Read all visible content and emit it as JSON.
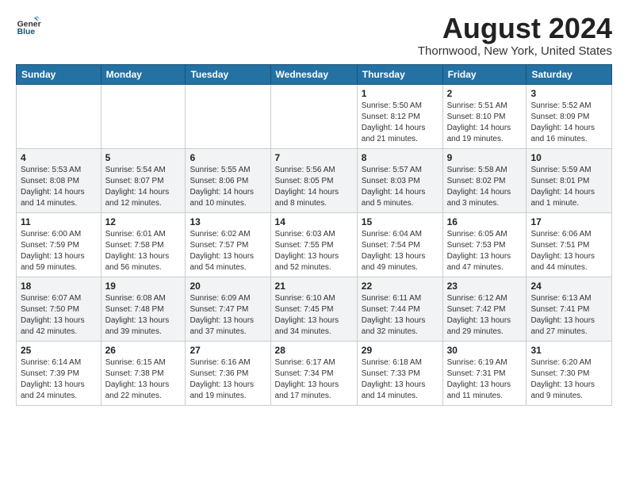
{
  "header": {
    "logo_line1": "General",
    "logo_line2": "Blue",
    "month_year": "August 2024",
    "location": "Thornwood, New York, United States"
  },
  "days_of_week": [
    "Sunday",
    "Monday",
    "Tuesday",
    "Wednesday",
    "Thursday",
    "Friday",
    "Saturday"
  ],
  "weeks": [
    [
      {
        "day": "",
        "info": ""
      },
      {
        "day": "",
        "info": ""
      },
      {
        "day": "",
        "info": ""
      },
      {
        "day": "",
        "info": ""
      },
      {
        "day": "1",
        "info": "Sunrise: 5:50 AM\nSunset: 8:12 PM\nDaylight: 14 hours\nand 21 minutes."
      },
      {
        "day": "2",
        "info": "Sunrise: 5:51 AM\nSunset: 8:10 PM\nDaylight: 14 hours\nand 19 minutes."
      },
      {
        "day": "3",
        "info": "Sunrise: 5:52 AM\nSunset: 8:09 PM\nDaylight: 14 hours\nand 16 minutes."
      }
    ],
    [
      {
        "day": "4",
        "info": "Sunrise: 5:53 AM\nSunset: 8:08 PM\nDaylight: 14 hours\nand 14 minutes."
      },
      {
        "day": "5",
        "info": "Sunrise: 5:54 AM\nSunset: 8:07 PM\nDaylight: 14 hours\nand 12 minutes."
      },
      {
        "day": "6",
        "info": "Sunrise: 5:55 AM\nSunset: 8:06 PM\nDaylight: 14 hours\nand 10 minutes."
      },
      {
        "day": "7",
        "info": "Sunrise: 5:56 AM\nSunset: 8:05 PM\nDaylight: 14 hours\nand 8 minutes."
      },
      {
        "day": "8",
        "info": "Sunrise: 5:57 AM\nSunset: 8:03 PM\nDaylight: 14 hours\nand 5 minutes."
      },
      {
        "day": "9",
        "info": "Sunrise: 5:58 AM\nSunset: 8:02 PM\nDaylight: 14 hours\nand 3 minutes."
      },
      {
        "day": "10",
        "info": "Sunrise: 5:59 AM\nSunset: 8:01 PM\nDaylight: 14 hours\nand 1 minute."
      }
    ],
    [
      {
        "day": "11",
        "info": "Sunrise: 6:00 AM\nSunset: 7:59 PM\nDaylight: 13 hours\nand 59 minutes."
      },
      {
        "day": "12",
        "info": "Sunrise: 6:01 AM\nSunset: 7:58 PM\nDaylight: 13 hours\nand 56 minutes."
      },
      {
        "day": "13",
        "info": "Sunrise: 6:02 AM\nSunset: 7:57 PM\nDaylight: 13 hours\nand 54 minutes."
      },
      {
        "day": "14",
        "info": "Sunrise: 6:03 AM\nSunset: 7:55 PM\nDaylight: 13 hours\nand 52 minutes."
      },
      {
        "day": "15",
        "info": "Sunrise: 6:04 AM\nSunset: 7:54 PM\nDaylight: 13 hours\nand 49 minutes."
      },
      {
        "day": "16",
        "info": "Sunrise: 6:05 AM\nSunset: 7:53 PM\nDaylight: 13 hours\nand 47 minutes."
      },
      {
        "day": "17",
        "info": "Sunrise: 6:06 AM\nSunset: 7:51 PM\nDaylight: 13 hours\nand 44 minutes."
      }
    ],
    [
      {
        "day": "18",
        "info": "Sunrise: 6:07 AM\nSunset: 7:50 PM\nDaylight: 13 hours\nand 42 minutes."
      },
      {
        "day": "19",
        "info": "Sunrise: 6:08 AM\nSunset: 7:48 PM\nDaylight: 13 hours\nand 39 minutes."
      },
      {
        "day": "20",
        "info": "Sunrise: 6:09 AM\nSunset: 7:47 PM\nDaylight: 13 hours\nand 37 minutes."
      },
      {
        "day": "21",
        "info": "Sunrise: 6:10 AM\nSunset: 7:45 PM\nDaylight: 13 hours\nand 34 minutes."
      },
      {
        "day": "22",
        "info": "Sunrise: 6:11 AM\nSunset: 7:44 PM\nDaylight: 13 hours\nand 32 minutes."
      },
      {
        "day": "23",
        "info": "Sunrise: 6:12 AM\nSunset: 7:42 PM\nDaylight: 13 hours\nand 29 minutes."
      },
      {
        "day": "24",
        "info": "Sunrise: 6:13 AM\nSunset: 7:41 PM\nDaylight: 13 hours\nand 27 minutes."
      }
    ],
    [
      {
        "day": "25",
        "info": "Sunrise: 6:14 AM\nSunset: 7:39 PM\nDaylight: 13 hours\nand 24 minutes."
      },
      {
        "day": "26",
        "info": "Sunrise: 6:15 AM\nSunset: 7:38 PM\nDaylight: 13 hours\nand 22 minutes."
      },
      {
        "day": "27",
        "info": "Sunrise: 6:16 AM\nSunset: 7:36 PM\nDaylight: 13 hours\nand 19 minutes."
      },
      {
        "day": "28",
        "info": "Sunrise: 6:17 AM\nSunset: 7:34 PM\nDaylight: 13 hours\nand 17 minutes."
      },
      {
        "day": "29",
        "info": "Sunrise: 6:18 AM\nSunset: 7:33 PM\nDaylight: 13 hours\nand 14 minutes."
      },
      {
        "day": "30",
        "info": "Sunrise: 6:19 AM\nSunset: 7:31 PM\nDaylight: 13 hours\nand 11 minutes."
      },
      {
        "day": "31",
        "info": "Sunrise: 6:20 AM\nSunset: 7:30 PM\nDaylight: 13 hours\nand 9 minutes."
      }
    ]
  ]
}
